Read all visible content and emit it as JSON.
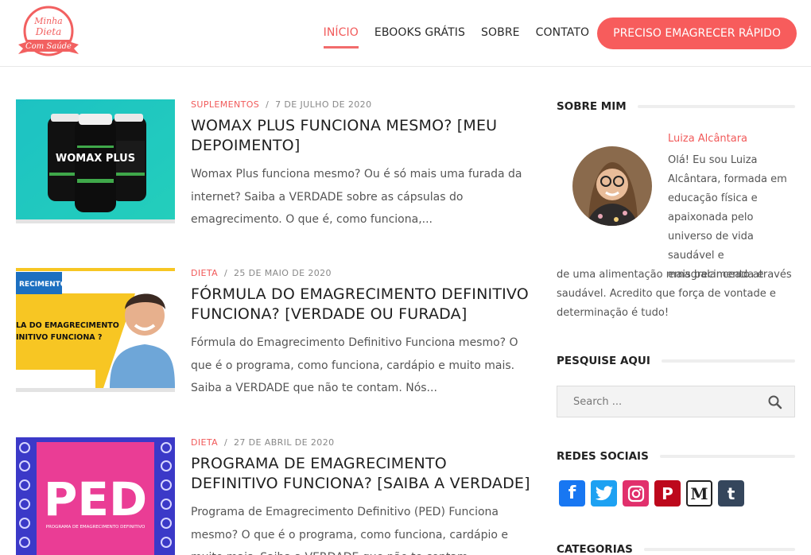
{
  "header": {
    "logo_text": "Minha Dieta Com Saúde",
    "nav": [
      {
        "label": "INÍCIO",
        "active": true
      },
      {
        "label": "EBOOKS GRÁTIS",
        "active": false
      },
      {
        "label": "SOBRE",
        "active": false
      },
      {
        "label": "CONTATO",
        "active": false
      }
    ],
    "cta_label": "PRECISO EMAGRECER RÁPIDO"
  },
  "posts": [
    {
      "category": "SUPLEMENTOS",
      "sep": "/",
      "date": "7 DE JULHO DE 2020",
      "title": "WOMAX PLUS FUNCIONA MESMO? [MEU DEPOIMENTO]",
      "excerpt": "Womax Plus funciona mesmo? Ou é só mais uma furada da internet? Saiba a VERDADE sobre as cápsulas do emagrecimento. O que é, como funciona,...",
      "thumb_text": "WOMAX PLUS"
    },
    {
      "category": "DIETA",
      "sep": "/",
      "date": "25 DE MAIO DE 2020",
      "title": "FÓRMULA DO EMAGRECIMENTO DEFINITIVO FUNCIONA? [VERDADE OU FURADA]",
      "excerpt": "Fórmula do Emagrecimento Definitivo Funciona mesmo? O que é o programa, como funciona, cardápio e muito mais. Saiba a VERDADE que não te contam. Nós...",
      "thumb_top": "RECIMENTO",
      "thumb_line1": "LA DO EMAGRECIMENTO",
      "thumb_line2": "INITIVO FUNCIONA ?"
    },
    {
      "category": "DIETA",
      "sep": "/",
      "date": "27 DE ABRIL DE 2020",
      "title": "PROGRAMA DE EMAGRECIMENTO DEFINITIVO FUNCIONA? [SAIBA A VERDADE]",
      "excerpt": "Programa de Emagrecimento Definitivo (PED) Funciona mesmo? O que é o programa, como funciona, cardápio e muito mais. Saiba a VERDADE que não te contam...",
      "thumb_text": "PED",
      "thumb_sub": "PROGRAMA DE EMAGRECIMENTO DEFINITIVO"
    }
  ],
  "sidebar": {
    "about_title": "SOBRE MIM",
    "about_name": "Luiza Alcântara",
    "about_text_top": "Olá! Eu sou Luiza Alcântara, formada em educação física e apaixonada pelo universo de vida saudável e emagrecimento através",
    "about_text_bottom": "de uma alimentação mais balanceada e saudável. Acredito que força de vontade e determinação é tudo!",
    "search_title": "PESQUISE AQUI",
    "search_placeholder": "Search ...",
    "social_title": "REDES SOCIAIS",
    "socials": [
      {
        "name": "facebook",
        "glyph": "f",
        "color": "#1877f2"
      },
      {
        "name": "twitter",
        "glyph": "t",
        "color": "#1da1f2"
      },
      {
        "name": "instagram",
        "glyph": "◎",
        "color": "#e1306c"
      },
      {
        "name": "pinterest",
        "glyph": "P",
        "color": "#bd081c"
      },
      {
        "name": "medium",
        "glyph": "M",
        "color": "#222222"
      },
      {
        "name": "tumblr",
        "glyph": "t",
        "color": "#35465c"
      }
    ],
    "categories_title": "CATEGORIAS"
  },
  "colors": {
    "accent": "#f15a5a",
    "cta": "#f75c5c"
  }
}
